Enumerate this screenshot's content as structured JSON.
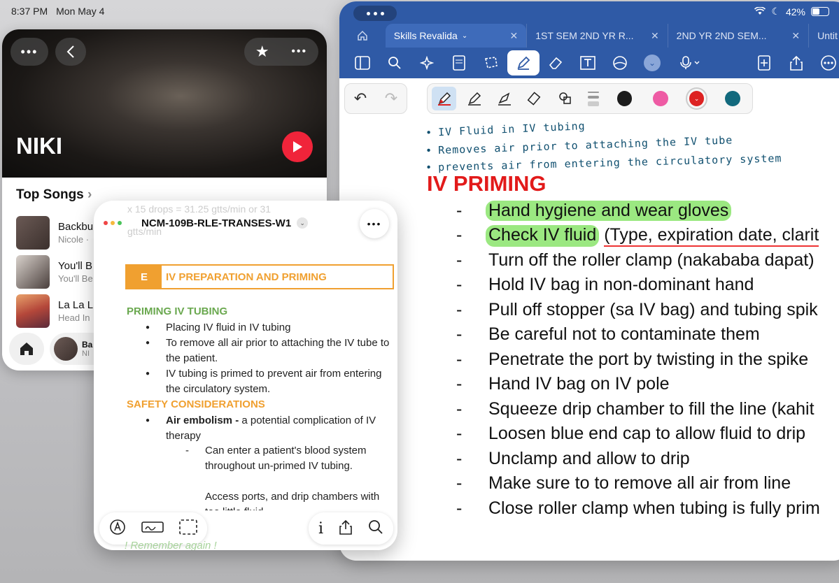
{
  "status": {
    "time": "8:37 PM",
    "date": "Mon May 4",
    "battery": "42%"
  },
  "colors": {
    "word_blue": "#2f5aa6",
    "music_red": "#f0243a",
    "doc_orange": "#f0a030",
    "doc_green": "#6aa84f",
    "highlight_green": "#9be881",
    "title_red": "#e21a1a"
  },
  "notes": {
    "tabs": [
      {
        "label": "Skills Revalida",
        "active": true
      },
      {
        "label": "1ST SEM 2ND YR R...",
        "active": false
      },
      {
        "label": "2ND YR 2ND SEM...",
        "active": false
      },
      {
        "label": "Untit",
        "active": false
      }
    ],
    "toolbar_icons": [
      "sidebar-icon",
      "search-icon",
      "sparkle-icon",
      "page-icon",
      "lasso-icon",
      "pen-icon",
      "eraser-icon",
      "text-box-icon",
      "shapes-icon",
      "chevron-down-icon",
      "microphone-icon",
      "add-page-icon",
      "share-icon",
      "more-icon"
    ],
    "pen_colors": [
      "#1c1c1c",
      "#ee5ba4",
      "#dd2222",
      "#12697d"
    ],
    "handwritten": [
      "IV Fluid in IV tubing",
      "Removes air prior to attaching the IV tube",
      "prevents air from entering the circulatory system"
    ],
    "heading": "IV PRIMING",
    "dash": "-",
    "steps": [
      {
        "text": "Hand hygiene and wear gloves"
      },
      {
        "text": "Check IV fluid",
        "rest_underlined": "(Type, expiration date, clarit"
      },
      {
        "text": "Turn off the roller clamp (nakababa dapat)"
      },
      {
        "text": "Hold IV bag in non-dominant hand"
      },
      {
        "text": "Pull off stopper (sa IV bag) and tubing spik"
      },
      {
        "text": "Be careful not to contaminate them"
      },
      {
        "text": "Penetrate the port by twisting in the spike"
      },
      {
        "text": "Hand IV bag on IV pole"
      },
      {
        "text": "Squeeze drip chamber to fill the line (kahit"
      },
      {
        "text": "Loosen blue end cap to allow fluid to drip"
      },
      {
        "text": "Unclamp and allow to drip"
      },
      {
        "text": "Make sure to to remove all air from line"
      },
      {
        "text": "Close roller clamp when tubing is fully prim"
      }
    ]
  },
  "music": {
    "artist": "NIKI",
    "section_title": "Top Songs",
    "songs": [
      {
        "title": "Backbu",
        "subtitle": "Nicole ·"
      },
      {
        "title": "You'll B",
        "subtitle": "You'll Be"
      },
      {
        "title": "La La L",
        "subtitle": "Head In"
      }
    ],
    "now_playing": {
      "title": "Ba",
      "subtitle": "NI"
    }
  },
  "doc": {
    "title": "NCM-109B-RLE-TRANSES-W1",
    "bg_text": "x 15 drops = 31.25 gtts/min or 31",
    "bg_text2": "gtts/min",
    "section_letter": "E",
    "section_title": "IV PREPARATION AND PRIMING",
    "priming_heading": "PRIMING IV TUBING",
    "priming_items": [
      "Placing IV fluid in IV tubing",
      "To remove all air prior to attaching the IV tube to the patient.",
      "IV tubing is primed to prevent air from entering the circulatory system."
    ],
    "safety_heading": "SAFETY CONSIDERATIONS",
    "safety_bold": "Air embolism -",
    "safety_rest": " a potential complication of IV therapy",
    "sub_items": [
      "Can enter a patient's blood system throughout un-primed IV tubing.",
      "Access ports, and drip chambers with too little fluid"
    ],
    "remember": "! Remember again !"
  }
}
